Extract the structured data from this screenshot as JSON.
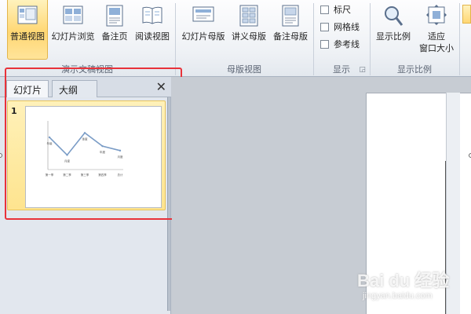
{
  "ribbon": {
    "presentation_views": {
      "group_label": "演示文稿视图",
      "normal_label": "普通视图",
      "slide_sorter_label": "幻灯片浏览",
      "notes_page_label": "备注页",
      "reading_view_label": "阅读视图"
    },
    "master_views": {
      "group_label": "母版视图",
      "slide_master_label": "幻灯片母版",
      "handout_master_label": "讲义母版",
      "notes_master_label": "备注母版"
    },
    "show": {
      "group_label": "显示",
      "ruler_label": "标尺",
      "gridlines_label": "网格线",
      "guides_label": "参考线"
    },
    "zoom": {
      "group_label": "显示比例",
      "zoom_label": "显示比例",
      "fit_line1": "适应",
      "fit_line2": "窗口大小"
    }
  },
  "panel": {
    "tabs": [
      {
        "label": "幻灯片",
        "selected": true
      },
      {
        "label": "大纲",
        "selected": false
      }
    ],
    "close_glyph": "✕",
    "slides": [
      {
        "number": "1"
      }
    ]
  },
  "thumbnail_chart": {
    "type": "line",
    "values": [
      56,
      48,
      58,
      52,
      50
    ],
    "point_labels": [
      "年级",
      "月度",
      "季度",
      "年度",
      "月度"
    ],
    "categories": [
      "第一季",
      "第二季",
      "第三季",
      "第四季",
      "总计"
    ],
    "line_color": "#7a9cc6"
  },
  "watermark": {
    "brand": "Bai du 经验",
    "sub": "jingyan.baidu.com"
  },
  "colors": {
    "active_button": "#ffd773",
    "highlight_border": "#e8323a",
    "selected_slide_bg": "#fee48f"
  }
}
